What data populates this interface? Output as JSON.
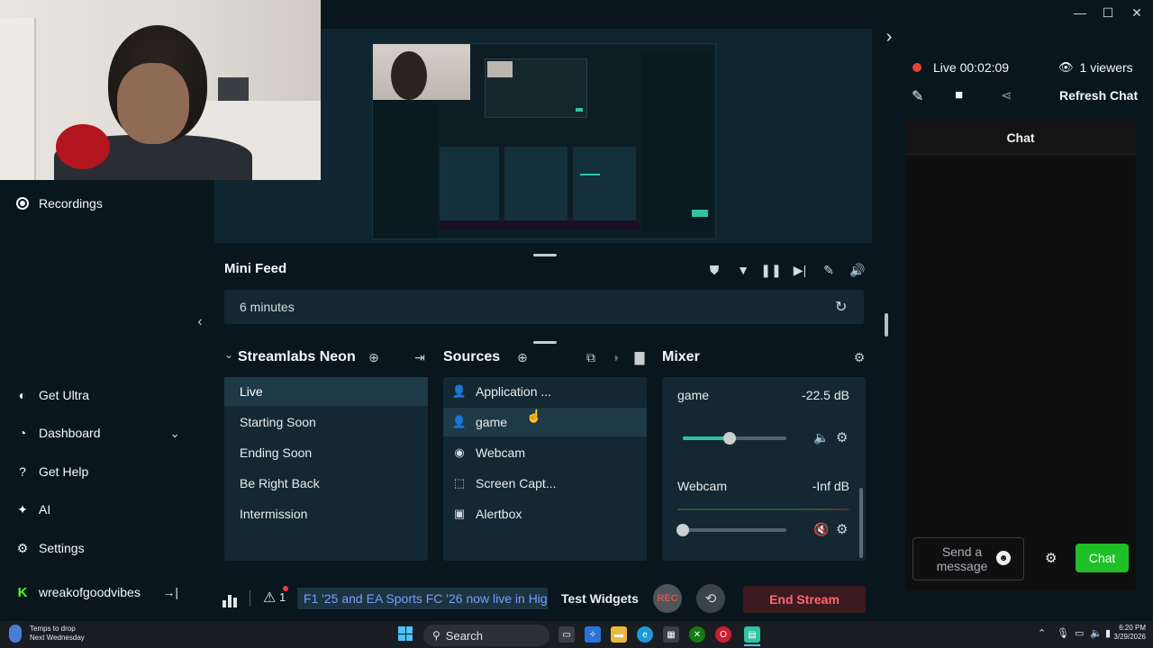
{
  "window": {
    "controls": {
      "minimize": "—",
      "maximize": "☐",
      "close": "✕"
    },
    "expand_arrow": "›"
  },
  "nav": {
    "items": [
      {
        "label": "Recordings",
        "icon": "record-circle-icon"
      },
      {
        "label": "Get Ultra",
        "icon": "ultra-icon"
      },
      {
        "label": "Dashboard",
        "icon": "dashboard-icon",
        "chevron": "⌄"
      },
      {
        "label": "Get Help",
        "icon": "help-icon"
      },
      {
        "label": "AI",
        "icon": "sparkle-icon"
      },
      {
        "label": "Settings",
        "icon": "gear-icon"
      }
    ],
    "user": {
      "name": "wreakofgoodvibes",
      "icon": "kick-icon",
      "logout_icon": "logout-icon"
    },
    "collapse_arrow": "‹"
  },
  "mini_feed": {
    "title": "Mini Feed",
    "row_text": "6 minutes",
    "icons": [
      "shield-icon",
      "filter-icon",
      "pause-icon",
      "skip-icon",
      "mute-notifications-icon",
      "volume-icon"
    ]
  },
  "scenes": {
    "title": "Streamlabs Neon",
    "items": [
      "Live",
      "Starting Soon",
      "Ending Soon",
      "Be Right Back",
      "Intermission"
    ],
    "active_index": 0
  },
  "sources": {
    "title": "Sources",
    "items": [
      {
        "label": "Application ...",
        "icon": "person-icon"
      },
      {
        "label": "game",
        "icon": "person-icon"
      },
      {
        "label": "Webcam",
        "icon": "webcam-icon"
      },
      {
        "label": "Screen Capt...",
        "icon": "screen-capture-icon"
      },
      {
        "label": "Alertbox",
        "icon": "alertbox-icon"
      }
    ]
  },
  "mixer": {
    "title": "Mixer",
    "channels": [
      {
        "name": "game",
        "level": "-22.5 dB",
        "volume_fraction": 0.45
      },
      {
        "name": "Webcam",
        "level": "-Inf dB",
        "volume_fraction": 0.0
      }
    ]
  },
  "footer": {
    "alert_count": "1",
    "ticker": "F1 '25 and EA Sports FC '26 now live in Hig",
    "test_widgets": "Test Widgets",
    "rec_label": "REC",
    "end_stream": "End Stream"
  },
  "chat": {
    "live_label": "Live",
    "live_time": "00:02:09",
    "viewers": "1 viewers",
    "refresh": "Refresh Chat",
    "header": "Chat",
    "input_placeholder": "Send a message",
    "send_button": "Chat"
  },
  "taskbar": {
    "weather_line1": "Temps to drop",
    "weather_line2": "Next Wednesday",
    "search": "Search",
    "time": "6:20 PM",
    "date": "3/29/2026"
  },
  "colors": {
    "accent_green": "#1fbf27",
    "slider_green": "#31c3a2",
    "end_stream_red": "#ff6670",
    "live_dot": "#e8403a"
  }
}
